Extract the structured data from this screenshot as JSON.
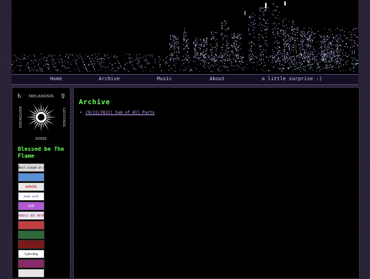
{
  "nav": [
    {
      "label": "Home"
    },
    {
      "label": "Archive"
    },
    {
      "label": "Music"
    },
    {
      "label": "About"
    },
    {
      "label": "a little surprise :)"
    }
  ],
  "sidebar": {
    "sigil": {
      "top": "MELANOSIS",
      "left": "XANTHOSIS",
      "right": "LEUCOSIS",
      "bottom": "IOSIS"
    },
    "tagline": "Blessed be The Flame",
    "badges": [
      {
        "text": "Best viewed on desktop",
        "bg": "#d8d8d8",
        "fg": "#000000"
      },
      {
        "text": "",
        "bg": "#5a8fd6",
        "fg": "#ffffff"
      },
      {
        "text": "WARNING",
        "bg": "#e8e8e8",
        "fg": "#c00000"
      },
      {
        "text": "made with",
        "bg": "#ffffff",
        "fg": "#5a2a8a"
      },
      {
        "text": "LOVE",
        "bg": "#b05ad6",
        "fg": "#ffffff"
      },
      {
        "text": "ANGELS ARE ANTHROPOMORPHIC",
        "bg": "#f0e6f0",
        "fg": "#7a2a4a"
      },
      {
        "text": "",
        "bg": "#c04040",
        "fg": "#ffffff"
      },
      {
        "text": "",
        "bg": "#2f6a3a",
        "fg": "#ffffff"
      },
      {
        "text": "",
        "bg": "#7a1a1a",
        "fg": "#ffffff"
      },
      {
        "text": "Cyberdog",
        "bg": "#ffffff",
        "fg": "#000000"
      },
      {
        "text": "",
        "bg": "#8a2a6a",
        "fg": "#ffffff"
      },
      {
        "text": "",
        "bg": "#e6e6e6",
        "fg": "#000000"
      }
    ]
  },
  "main": {
    "heading": "Archive",
    "posts": [
      {
        "title": "(9/22/2022) Sum of All Parts"
      }
    ]
  },
  "colors": {
    "accent_green": "#6cff5a",
    "link_purple": "#c9a8ff",
    "nav_text": "#d6c6ff"
  }
}
